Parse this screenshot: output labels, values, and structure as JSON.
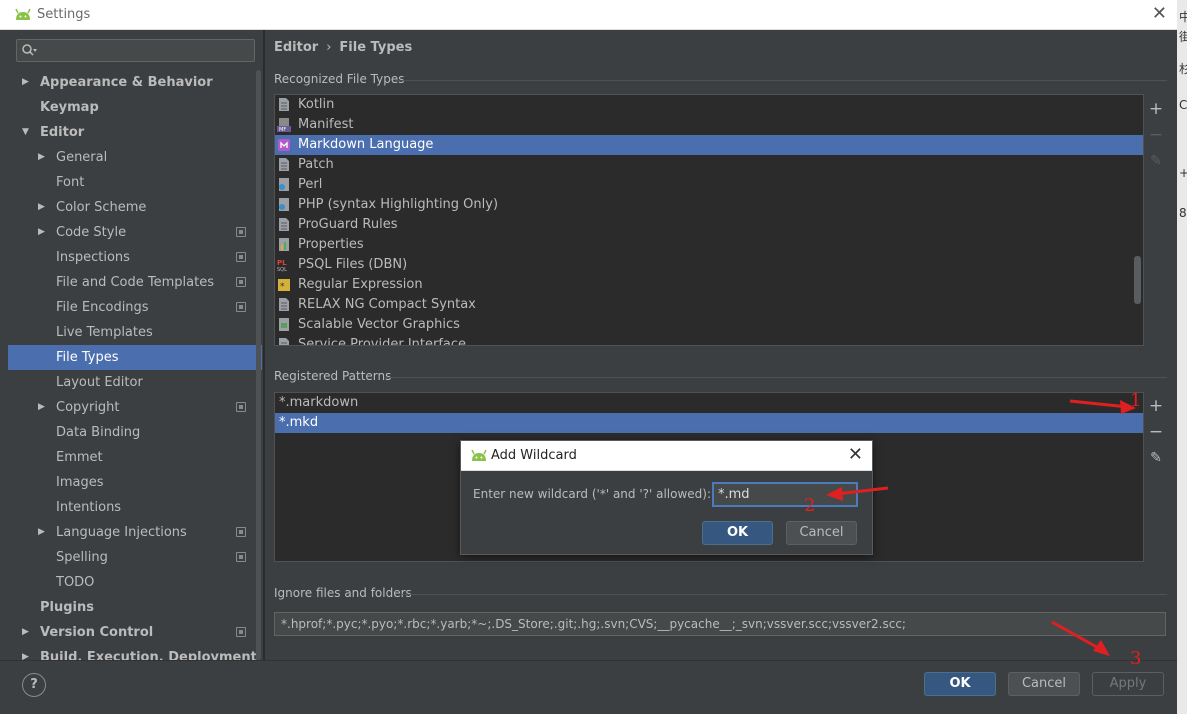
{
  "window": {
    "title": "Settings",
    "close_glyph": "✕"
  },
  "background_window_chars": [
    "中",
    "街",
    "杉",
    "C",
    "+",
    "8"
  ],
  "search": {
    "value": "",
    "placeholder": ""
  },
  "sidebar": {
    "items": [
      {
        "label": "Appearance & Behavior",
        "level": 0,
        "expandable": true,
        "expanded": false,
        "bold": true,
        "project": false
      },
      {
        "label": "Keymap",
        "level": 0,
        "expandable": false,
        "bold": true,
        "project": false
      },
      {
        "label": "Editor",
        "level": 0,
        "expandable": true,
        "expanded": true,
        "bold": true,
        "project": false
      },
      {
        "label": "General",
        "level": 1,
        "expandable": true,
        "expanded": false,
        "bold": false,
        "project": false
      },
      {
        "label": "Font",
        "level": 1,
        "expandable": false,
        "bold": false,
        "project": false
      },
      {
        "label": "Color Scheme",
        "level": 1,
        "expandable": true,
        "expanded": false,
        "bold": false,
        "project": false
      },
      {
        "label": "Code Style",
        "level": 1,
        "expandable": true,
        "expanded": false,
        "bold": false,
        "project": true
      },
      {
        "label": "Inspections",
        "level": 1,
        "expandable": false,
        "bold": false,
        "project": true
      },
      {
        "label": "File and Code Templates",
        "level": 1,
        "expandable": false,
        "bold": false,
        "project": true
      },
      {
        "label": "File Encodings",
        "level": 1,
        "expandable": false,
        "bold": false,
        "project": true
      },
      {
        "label": "Live Templates",
        "level": 1,
        "expandable": false,
        "bold": false,
        "project": false
      },
      {
        "label": "File Types",
        "level": 1,
        "expandable": false,
        "bold": false,
        "project": false,
        "selected": true
      },
      {
        "label": "Layout Editor",
        "level": 1,
        "expandable": false,
        "bold": false,
        "project": false
      },
      {
        "label": "Copyright",
        "level": 1,
        "expandable": true,
        "expanded": false,
        "bold": false,
        "project": true
      },
      {
        "label": "Data Binding",
        "level": 1,
        "expandable": false,
        "bold": false,
        "project": false
      },
      {
        "label": "Emmet",
        "level": 1,
        "expandable": false,
        "bold": false,
        "project": false
      },
      {
        "label": "Images",
        "level": 1,
        "expandable": false,
        "bold": false,
        "project": false
      },
      {
        "label": "Intentions",
        "level": 1,
        "expandable": false,
        "bold": false,
        "project": false
      },
      {
        "label": "Language Injections",
        "level": 1,
        "expandable": true,
        "expanded": false,
        "bold": false,
        "project": true
      },
      {
        "label": "Spelling",
        "level": 1,
        "expandable": false,
        "bold": false,
        "project": true
      },
      {
        "label": "TODO",
        "level": 1,
        "expandable": false,
        "bold": false,
        "project": false
      },
      {
        "label": "Plugins",
        "level": 0,
        "expandable": false,
        "bold": true,
        "project": false
      },
      {
        "label": "Version Control",
        "level": 0,
        "expandable": true,
        "expanded": false,
        "bold": true,
        "project": true
      },
      {
        "label": "Build, Execution, Deployment",
        "level": 0,
        "expandable": true,
        "expanded": false,
        "bold": true,
        "project": false
      }
    ]
  },
  "breadcrumb": {
    "parent": "Editor",
    "separator": "›",
    "current": "File Types"
  },
  "recognized": {
    "title": "Recognized File Types",
    "items": [
      {
        "label": "Kotlin",
        "icon": "file-icon"
      },
      {
        "label": "Manifest",
        "icon": "manifest-icon"
      },
      {
        "label": "Markdown Language",
        "icon": "markdown-icon",
        "selected": true
      },
      {
        "label": "Patch",
        "icon": "file-icon"
      },
      {
        "label": "Perl",
        "icon": "perl-icon"
      },
      {
        "label": "PHP (syntax Highlighting Only)",
        "icon": "perl-icon"
      },
      {
        "label": "ProGuard Rules",
        "icon": "file-icon"
      },
      {
        "label": "Properties",
        "icon": "properties-icon"
      },
      {
        "label": "PSQL Files (DBN)",
        "icon": "psql-icon"
      },
      {
        "label": "Regular Expression",
        "icon": "regex-icon"
      },
      {
        "label": "RELAX NG Compact Syntax",
        "icon": "file-icon"
      },
      {
        "label": "Scalable Vector Graphics",
        "icon": "svg-file-icon"
      },
      {
        "label": "Service Provider Interface",
        "icon": "file-icon"
      }
    ]
  },
  "patterns": {
    "title": "Registered Patterns",
    "items": [
      {
        "label": "*.markdown",
        "selected": false
      },
      {
        "label": "*.mkd",
        "selected": true
      }
    ]
  },
  "toolbar": {
    "add": "+",
    "remove": "−",
    "edit": "✎"
  },
  "ignore": {
    "title": "Ignore files and folders",
    "value": "*.hprof;*.pyc;*.pyo;*.rbc;*.yarb;*~;.DS_Store;.git;.hg;.svn;CVS;__pycache__;_svn;vssver.scc;vssver2.scc;"
  },
  "dialog": {
    "title": "Add Wildcard",
    "prompt": "Enter new wildcard ('*' and '?' allowed):",
    "value": "*.md",
    "ok": "OK",
    "cancel": "Cancel",
    "close_glyph": "✕"
  },
  "buttons": {
    "help": "?",
    "ok": "OK",
    "cancel": "Cancel",
    "apply": "Apply"
  },
  "annotations": [
    "1",
    "2",
    "3"
  ],
  "colors": {
    "selection": "#4b6eaf",
    "annotation": "#e02020",
    "primary_button": "#365880"
  }
}
